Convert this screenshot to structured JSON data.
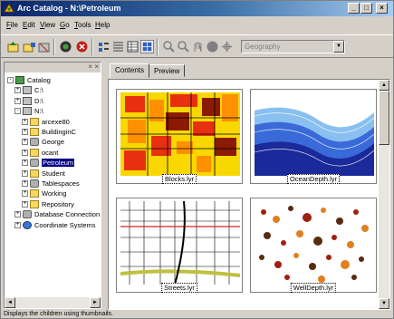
{
  "window": {
    "title": "Arc Catalog - N:\\Petroleum",
    "minimize": "_",
    "maximize": "□",
    "close": "×"
  },
  "menu": [
    {
      "key": "F",
      "rest": "ile"
    },
    {
      "key": "E",
      "rest": "dit"
    },
    {
      "key": "V",
      "rest": "iew"
    },
    {
      "key": "G",
      "rest": "o"
    },
    {
      "key": "T",
      "rest": "ools"
    },
    {
      "key": "H",
      "rest": "elp"
    }
  ],
  "toolbar": {
    "combo_value": "Geography",
    "combo_arrow": "▼"
  },
  "tree": {
    "close": "× ×",
    "items": [
      {
        "label": "Catalog",
        "exp": "-",
        "icon": "catalog-icon"
      },
      {
        "label": "C:\\",
        "exp": "+",
        "icon": "drive-icon"
      },
      {
        "label": "D:\\",
        "exp": "+",
        "icon": "drive-icon"
      },
      {
        "label": "N:\\",
        "exp": "-",
        "icon": "drive-icon"
      },
      {
        "label": "arcexe80",
        "exp": "+",
        "icon": "folder-icon"
      },
      {
        "label": "BuildinginC",
        "exp": "+",
        "icon": "folder-icon"
      },
      {
        "label": "George",
        "exp": "+",
        "icon": "database-icon"
      },
      {
        "label": "ocant",
        "exp": "+",
        "icon": "folder-icon"
      },
      {
        "label": "Petroleum",
        "exp": "+",
        "icon": "database-icon"
      },
      {
        "label": "Student",
        "exp": "+",
        "icon": "folder-icon"
      },
      {
        "label": "Tablespaces",
        "exp": "+",
        "icon": "database-icon"
      },
      {
        "label": "Working",
        "exp": "+",
        "icon": "folder-icon"
      },
      {
        "label": "Repository",
        "exp": "+",
        "icon": "folder-icon"
      },
      {
        "label": "Database Connection",
        "exp": "+",
        "icon": "database-icon"
      },
      {
        "label": "Coordinate Systems",
        "exp": "+",
        "icon": "globe-icon"
      }
    ],
    "scroll_left": "◄",
    "scroll_right": "►"
  },
  "tabs": [
    {
      "label": "Contents"
    },
    {
      "label": "Preview"
    }
  ],
  "thumbnails": [
    {
      "caption": "Blocks.lyr",
      "colors": [
        "#e83010",
        "#f8d800",
        "#ff9000",
        "#8a1a00"
      ]
    },
    {
      "caption": "OceanDepth.lyr",
      "colors": [
        "#1a2a9a",
        "#3a6ad8",
        "#8ac0f0",
        "#ffffff"
      ]
    },
    {
      "caption": "Streets.lyr",
      "colors": [
        "#000000",
        "#d02020",
        "#c0c040",
        "#ffffff"
      ]
    },
    {
      "caption": "WellDepth.lyr",
      "colors": [
        "#a02010",
        "#e08020",
        "#5a2a10",
        "#ffffff"
      ]
    }
  ],
  "vscroll": {
    "up": "▲",
    "down": "▼"
  },
  "status": "Displays the children using thumbnails."
}
